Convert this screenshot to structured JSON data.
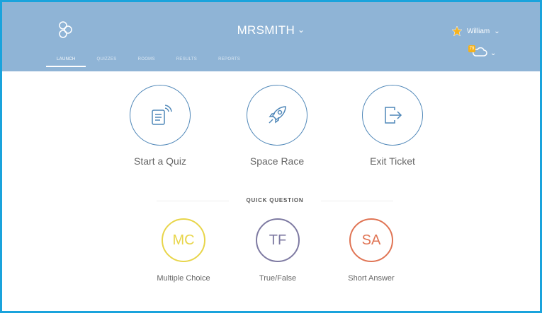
{
  "header": {
    "class_name": "MRSMITH",
    "user_name": "William",
    "cloud_badge": "79"
  },
  "nav": [
    {
      "label": "LAUNCH"
    },
    {
      "label": "QUIZZES"
    },
    {
      "label": "ROOMS"
    },
    {
      "label": "RESULTS"
    },
    {
      "label": "REPORTS"
    }
  ],
  "activities": {
    "start_quiz": "Start a Quiz",
    "space_race": "Space Race",
    "exit_ticket": "Exit Ticket"
  },
  "quick_question": {
    "title": "QUICK QUESTION",
    "mc": {
      "abbr": "MC",
      "label": "Multiple Choice",
      "color": "#e8d54a"
    },
    "tf": {
      "abbr": "TF",
      "label": "True/False",
      "color": "#7e7aa2"
    },
    "sa": {
      "abbr": "SA",
      "label": "Short Answer",
      "color": "#e07454"
    }
  },
  "colors": {
    "header_bg": "#8fb4d6",
    "frame_border": "#1aa3dc",
    "circle_stroke": "#4f87b8"
  }
}
